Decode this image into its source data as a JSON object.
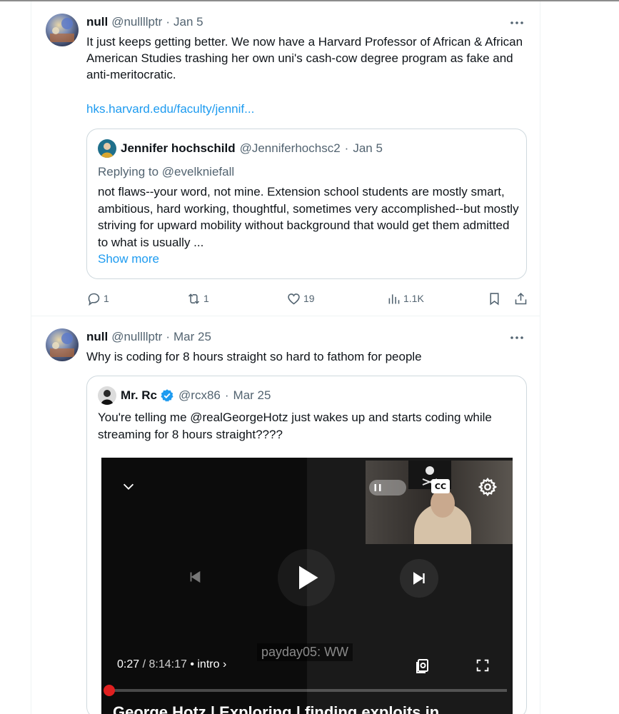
{
  "posts": [
    {
      "author": {
        "name": "null",
        "handle": "@nullllptr",
        "date": "Jan 5"
      },
      "text": "It just keeps getting better. We now have a Harvard Professor of African & African American Studies trashing her own uni's cash-cow degree program as fake and anti-meritocratic.",
      "link": "hks.harvard.edu/faculty/jennif...",
      "quote": {
        "name": "Jennifer hochschild",
        "handle": "@Jenniferhochsc2",
        "date": "Jan 5",
        "replying": "Replying to @evelkniefall",
        "text": "not flaws--your word, not mine. Extension school students are mostly smart, ambitious, hard working, thoughtful, sometimes very accomplished--but mostly striving for upward mobility without background that would get them admitted to what is usually ...",
        "show_more": "Show more"
      },
      "actions": {
        "replies": "1",
        "reposts": "1",
        "likes": "19",
        "views": "1.1K"
      }
    },
    {
      "author": {
        "name": "null",
        "handle": "@nullllptr",
        "date": "Mar 25"
      },
      "text": "Why is coding for 8 hours straight so hard to fathom for people",
      "quote": {
        "name": "Mr. Rc",
        "handle": "@rcx86",
        "date": "Mar 25",
        "verified": true,
        "text": "You're telling me @realGeorgeHotz just wakes up and starts coding while streaming for 8 hours straight????",
        "video": {
          "current_time": "0:27",
          "duration": "/ 8:14:17",
          "chapter": "• intro ›",
          "cc_label": "CC",
          "watermark": "payday05: WW",
          "title": "George Hotz | Exploring | finding exploits in",
          "progress": 0.001
        }
      }
    }
  ],
  "colors": {
    "accent": "#1d9bf0",
    "secondary_text": "#536471",
    "border": "#cfd9de",
    "progress": "#e02020"
  },
  "icons": [
    "more-icon",
    "reply-icon",
    "repost-icon",
    "like-icon",
    "views-icon",
    "bookmark-icon",
    "share-icon",
    "verified-icon",
    "chevron-down-icon",
    "pause-icon",
    "cc-icon",
    "settings-icon",
    "previous-icon",
    "play-icon",
    "next-icon",
    "chapters-icon",
    "fullscreen-icon"
  ]
}
